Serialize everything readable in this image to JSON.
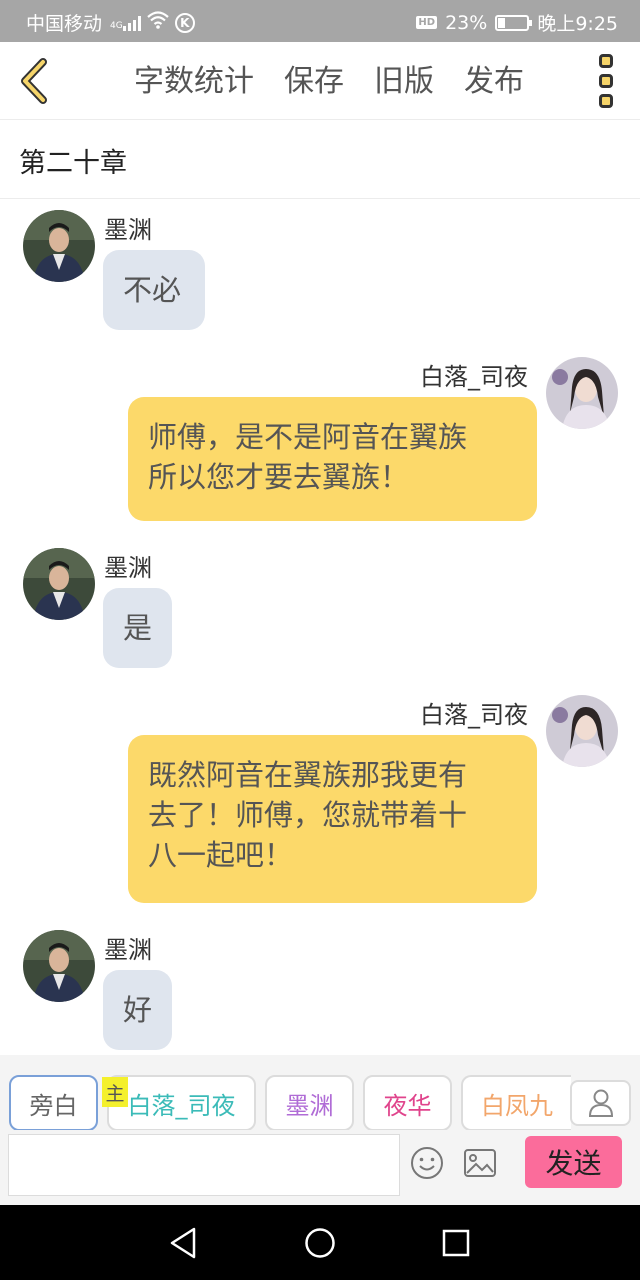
{
  "status_bar": {
    "carrier": "中国移动",
    "network": "4G",
    "hd": "HD",
    "battery": "23%",
    "battery_level": 0.23,
    "time": "晚上9:25"
  },
  "toolbar": {
    "word_count": "字数统计",
    "save": "保存",
    "old_version": "旧版",
    "publish": "发布"
  },
  "chapter_title": "第二十章",
  "messages": [
    {
      "speaker": "墨渊",
      "side": "left",
      "text": "不必"
    },
    {
      "speaker": "白落_司夜",
      "side": "right",
      "text_lines": [
        "师傅，是不是阿音在翼族",
        "所以您才要去翼族！"
      ]
    },
    {
      "speaker": "墨渊",
      "side": "left",
      "text": "是"
    },
    {
      "speaker": "白落_司夜",
      "side": "right",
      "text_lines": [
        "既然阿音在翼族那我更有",
        "去了！师傅，您就带着十",
        "八一起吧！"
      ]
    },
    {
      "speaker": "墨渊",
      "side": "left",
      "text": "好"
    }
  ],
  "roles": {
    "narration": "旁白",
    "main_tag": "主",
    "items": [
      {
        "label": "白落_司夜",
        "color": "#3bbbb8"
      },
      {
        "label": "墨渊",
        "color": "#b06cd6"
      },
      {
        "label": "夜华",
        "color": "#e0448c"
      },
      {
        "label": "白凤九",
        "color": "#f2a66b"
      }
    ]
  },
  "input": {
    "value": "",
    "send": "发送"
  },
  "icons": {
    "back": "chevron-left-icon",
    "more": "more-vertical-icon",
    "profile": "person-icon",
    "emoji": "smile-icon",
    "image": "image-icon"
  },
  "colors": {
    "accent": "#f6d56a",
    "right_bubble": "#fcd96a",
    "left_bubble": "#dfe5ee",
    "send": "#fb6c9b"
  }
}
